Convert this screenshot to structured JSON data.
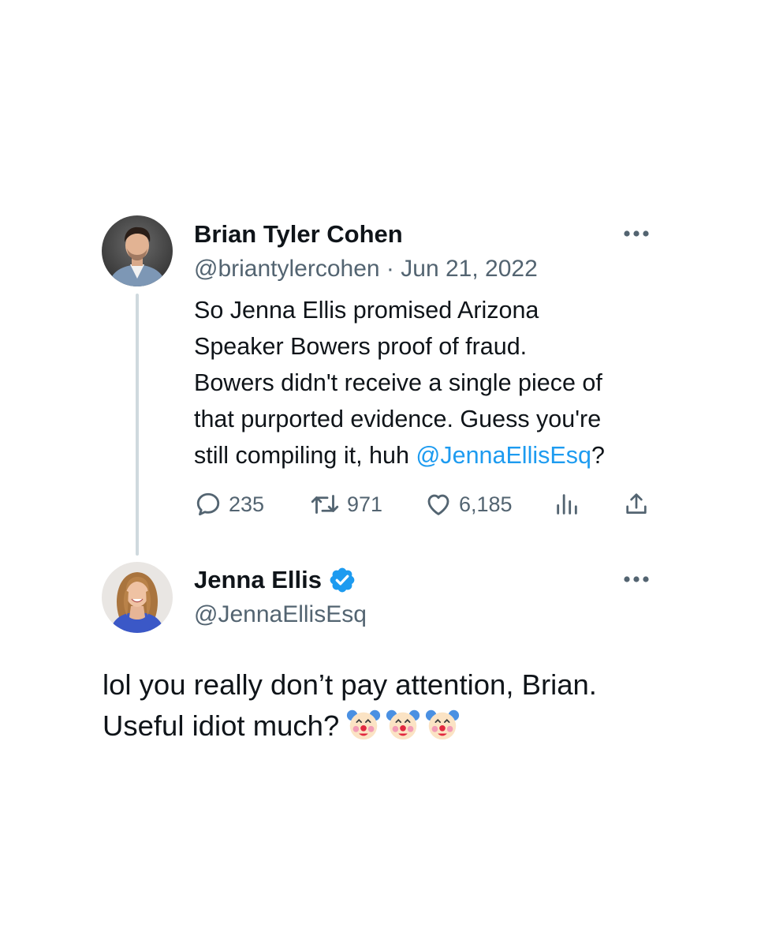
{
  "original_tweet": {
    "author_name": "Brian Tyler Cohen",
    "handle": "@briantylercohen",
    "separator": "·",
    "date": "Jun 21, 2022",
    "text_lines": [
      "So Jenna Ellis promised Arizona",
      "Speaker Bowers proof of fraud.",
      "Bowers didn't receive a single piece of",
      "that purported evidence. Guess you're",
      "still compiling it, huh "
    ],
    "mention": "@JennaEllisEsq",
    "text_end": "?",
    "stats": {
      "replies": "235",
      "retweets": "971",
      "likes": "6,185"
    },
    "icons": {
      "avatar": "avatar-photo",
      "more": "more-dots-icon",
      "reply": "reply-icon",
      "retweet": "retweet-icon",
      "like": "heart-icon",
      "views": "analytics-icon",
      "share": "share-icon"
    }
  },
  "reply_tweet": {
    "author_name": "Jenna Ellis",
    "verified": true,
    "handle": "@JennaEllisEsq",
    "text_lines": [
      "lol you really don’t pay attention, Brian.",
      "Useful idiot much?"
    ],
    "emoji": [
      "🤡",
      "🤡",
      "🤡"
    ],
    "icons": {
      "avatar": "avatar-photo",
      "verified": "verified-badge-icon",
      "more": "more-dots-icon",
      "emoji": "clown-face-icon"
    }
  },
  "colors": {
    "text": "#0f1419",
    "secondary": "#536471",
    "link": "#1d9bf0",
    "verified": "#1d9bf0",
    "thread_line": "#cfd9de",
    "background": "#ffffff"
  }
}
